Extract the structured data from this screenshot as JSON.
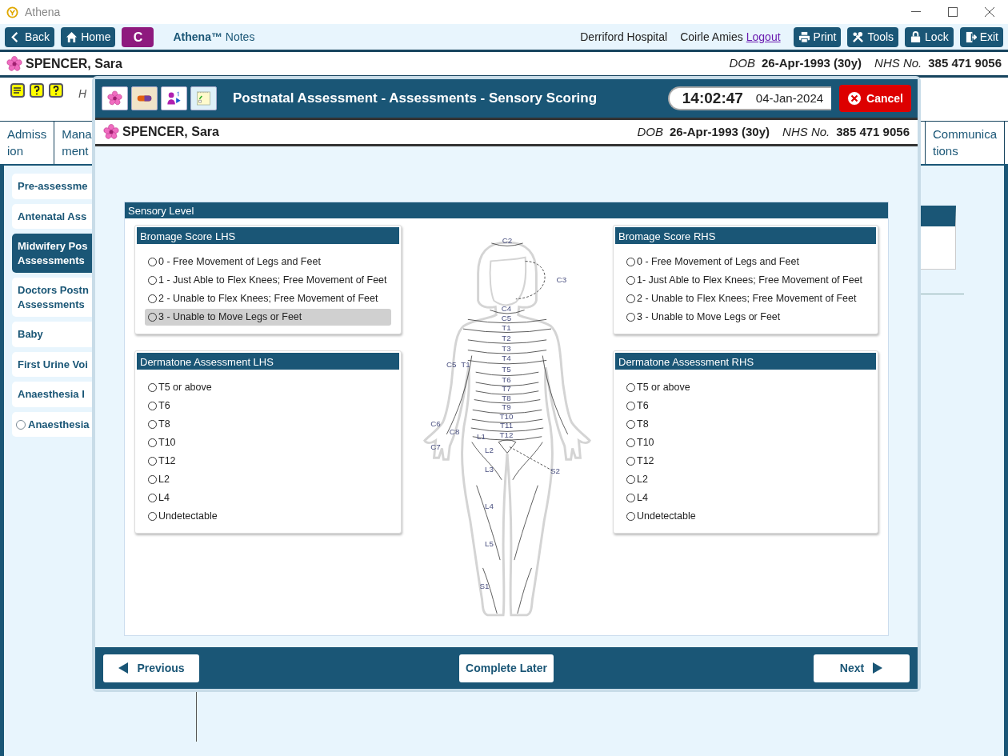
{
  "window": {
    "title": "Athena"
  },
  "toolbar": {
    "nav": [
      {
        "label": "Back"
      },
      {
        "label": "Home"
      }
    ],
    "c_button": "C",
    "brand": "Athena™",
    "brand_suffix": "Notes",
    "hospital": "Derriford Hospital",
    "user": "Coirle Amies",
    "logout": "Logout",
    "actions": [
      {
        "label": "Print"
      },
      {
        "label": "Tools"
      },
      {
        "label": "Lock"
      },
      {
        "label": "Exit"
      }
    ]
  },
  "patient": {
    "name": "SPENCER, Sara",
    "dob_label": "DOB",
    "dob": "26-Apr-1993 (30y)",
    "nhs_label": "NHS No.",
    "nhs": "385 471 9056"
  },
  "background": {
    "help_text": "H",
    "tabs": [
      {
        "label": "Admiss\nion"
      },
      {
        "label": "Mana\nment"
      },
      {
        "label": "Communica\ntions"
      }
    ],
    "sidebar": [
      {
        "label": "Pre-assessme",
        "kind": "link",
        "selected": false
      },
      {
        "label": "Antenatal Ass",
        "kind": "link",
        "selected": false
      },
      {
        "label": "Midwifery Pos\nAssessments",
        "kind": "link",
        "selected": true
      },
      {
        "label": "Doctors Postn\nAssessments",
        "kind": "link",
        "selected": false
      },
      {
        "label": "Baby",
        "kind": "link",
        "selected": false
      },
      {
        "label": "First Urine Voi",
        "kind": "link",
        "selected": false
      },
      {
        "label": "Anaesthesia I",
        "kind": "link",
        "selected": false
      },
      {
        "label": "Anaesthesia",
        "kind": "radio",
        "selected": false
      }
    ]
  },
  "modal": {
    "title": "Postnatal Assessment - Assessments - Sensory Scoring",
    "time": "14:02:47",
    "date": "04-Jan-2024",
    "cancel": "Cancel",
    "patient": {
      "name": "SPENCER, Sara",
      "dob_label": "DOB",
      "dob": "26-Apr-1993 (30y)",
      "nhs_label": "NHS No.",
      "nhs": "385 471 9056"
    },
    "section_title": "Sensory Level",
    "groups": [
      {
        "title": "Bromage Score LHS",
        "options": [
          {
            "label": "0 - Free Movement of Legs and Feet",
            "selected": false,
            "highlighted": false
          },
          {
            "label": "1 - Just Able to Flex Knees; Free Movement of Feet",
            "selected": false,
            "highlighted": false
          },
          {
            "label": "2 - Unable to Flex Knees; Free Movement of Feet",
            "selected": false,
            "highlighted": false
          },
          {
            "label": "3 - Unable to Move Legs or Feet",
            "selected": false,
            "highlighted": true
          }
        ]
      },
      {
        "title": "Dermatone Assessment LHS",
        "options": [
          {
            "label": "T5 or above",
            "selected": false,
            "highlighted": false
          },
          {
            "label": "T6",
            "selected": false,
            "highlighted": false
          },
          {
            "label": "T8",
            "selected": false,
            "highlighted": false
          },
          {
            "label": "T10",
            "selected": false,
            "highlighted": false
          },
          {
            "label": "T12",
            "selected": false,
            "highlighted": false
          },
          {
            "label": "L2",
            "selected": false,
            "highlighted": false
          },
          {
            "label": "L4",
            "selected": false,
            "highlighted": false
          },
          {
            "label": "Undetectable",
            "selected": false,
            "highlighted": false
          }
        ]
      },
      {
        "title": "Bromage Score RHS",
        "options": [
          {
            "label": "0 - Free Movement of Legs and Feet",
            "selected": false,
            "highlighted": false
          },
          {
            "label": "1- Just Able to Flex Knees; Free Movement of Feet",
            "selected": false,
            "highlighted": false
          },
          {
            "label": "2 - Unable to Flex Knees; Free Movement of Feet",
            "selected": false,
            "highlighted": false
          },
          {
            "label": "3 - Unable to Move Legs or Feet",
            "selected": false,
            "highlighted": false
          }
        ]
      },
      {
        "title": "Dermatone Assessment RHS",
        "options": [
          {
            "label": "T5 or above",
            "selected": false,
            "highlighted": false
          },
          {
            "label": "T6",
            "selected": false,
            "highlighted": false
          },
          {
            "label": "T8",
            "selected": false,
            "highlighted": false
          },
          {
            "label": "T10",
            "selected": false,
            "highlighted": false
          },
          {
            "label": "T12",
            "selected": false,
            "highlighted": false
          },
          {
            "label": "L2",
            "selected": false,
            "highlighted": false
          },
          {
            "label": "L4",
            "selected": false,
            "highlighted": false
          },
          {
            "label": "Undetectable",
            "selected": false,
            "highlighted": false
          }
        ]
      }
    ],
    "diagram_labels": [
      "C2",
      "C3",
      "C4",
      "C5",
      "T1",
      "T2",
      "T3",
      "T4",
      "C5",
      "T1",
      "T5",
      "T6",
      "T7",
      "T8",
      "T9",
      "T10",
      "T11",
      "T12",
      "C6",
      "C8",
      "C7",
      "L1",
      "L2",
      "S2",
      "L3",
      "L4",
      "L5",
      "S1"
    ],
    "footer": {
      "previous": "Previous",
      "complete_later": "Complete Later",
      "next": "Next"
    }
  }
}
